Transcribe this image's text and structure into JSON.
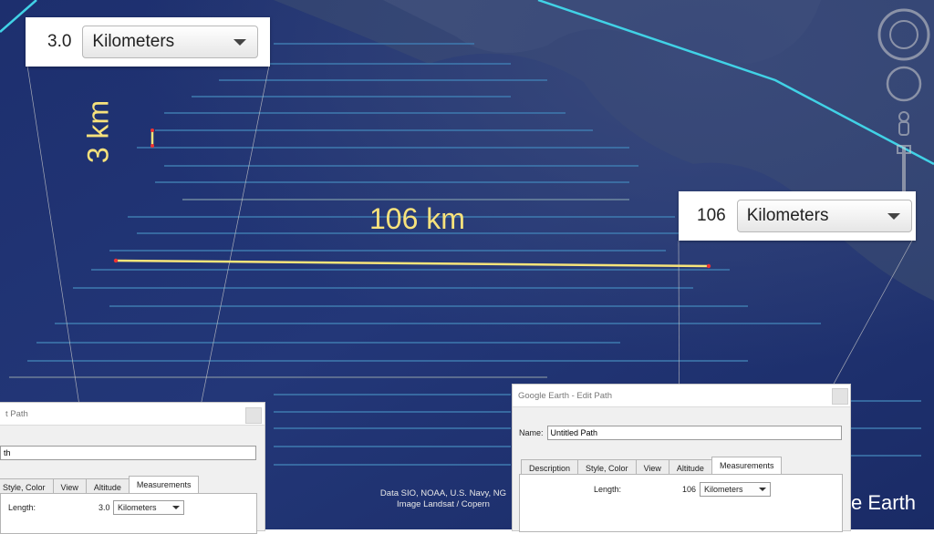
{
  "measurements": {
    "short_label": "3 km",
    "long_label": "106 km"
  },
  "callout_short": {
    "value": "3.0",
    "unit": "Kilometers"
  },
  "callout_long": {
    "value": "106",
    "unit": "Kilometers"
  },
  "dialog_left": {
    "title": "t Path",
    "name_value": "th",
    "tabs": [
      "Style, Color",
      "View",
      "Altitude",
      "Measurements"
    ],
    "active_tab": "Measurements",
    "length_label": "Length:",
    "length_value": "3.0",
    "unit": "Kilometers"
  },
  "dialog_right": {
    "title": "Google Earth - Edit Path",
    "name_label": "Name:",
    "name_value": "Untitled Path",
    "tabs": [
      "Description",
      "Style, Color",
      "View",
      "Altitude",
      "Measurements"
    ],
    "active_tab": "Measurements",
    "length_label": "Length:",
    "length_value": "106",
    "unit": "Kilometers"
  },
  "attribution": {
    "line1": "Data SIO, NOAA, U.S. Navy, NG",
    "line2": "Image Landsat / Copern"
  },
  "brand": "e Earth",
  "colors": {
    "ocean": "#1f3273",
    "measure_line": "#f7e57a",
    "border_line": "#41d2e6",
    "label": "#f7e27c"
  }
}
